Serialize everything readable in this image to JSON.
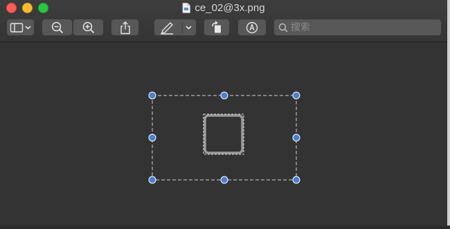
{
  "window": {
    "title": "ce_02@3x.png"
  },
  "toolbar": {
    "sidebar_button": "sidebar-toggle-icon",
    "zoom_out": "zoom-out-icon",
    "zoom_in": "zoom-in-icon",
    "share": "share-icon",
    "markup": "pen-icon",
    "rotate": "rotate-left-icon",
    "annotate": "markup-circle-icon"
  },
  "search": {
    "placeholder": "搜索",
    "value": ""
  },
  "colors": {
    "close": "#fc5f57",
    "minimize": "#fdbc2e",
    "maximize": "#28c840",
    "handle": "#4a7fd0",
    "background": "#333333"
  }
}
